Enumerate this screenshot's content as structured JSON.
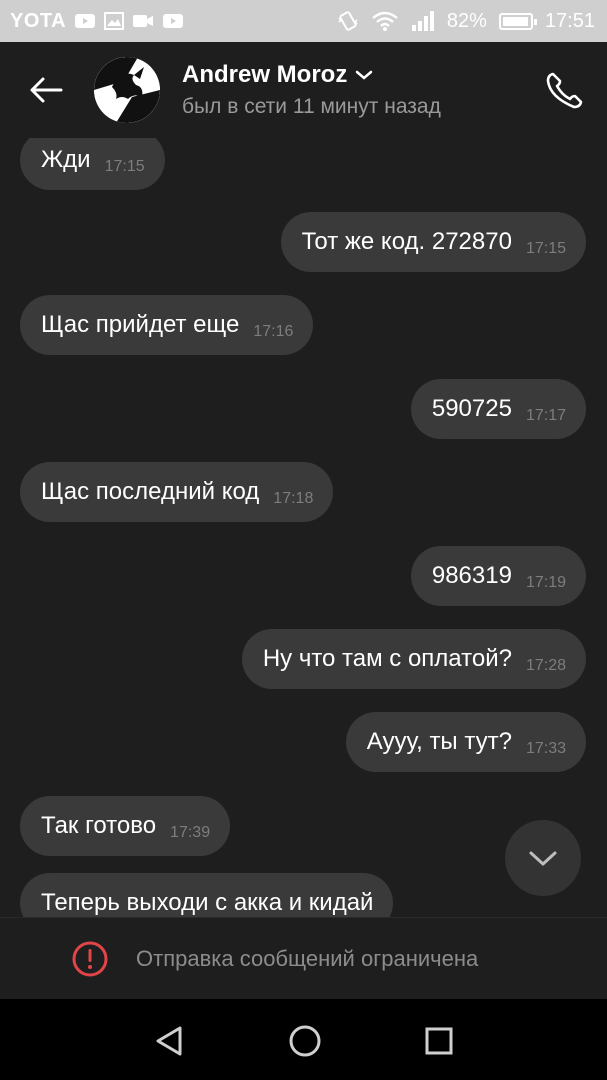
{
  "status_bar": {
    "carrier": "YOTA",
    "battery": "82%",
    "battery_level": 0.82,
    "time": "17:51",
    "icons": [
      "youtube-icon",
      "image-icon",
      "video-icon",
      "youtube-icon",
      "vibrate-icon",
      "wifi-icon",
      "signal-icon",
      "battery-icon"
    ]
  },
  "header": {
    "contact_name": "Andrew Moroz",
    "last_seen": "был в сети 11 минут назад"
  },
  "messages": [
    {
      "side": "in",
      "text": "Жди",
      "time": "17:15"
    },
    {
      "side": "out",
      "text": "Тот же код. 272870",
      "time": "17:15"
    },
    {
      "side": "in",
      "text": "Щас прийдет еще",
      "time": "17:16"
    },
    {
      "side": "out",
      "text": "590725",
      "time": "17:17"
    },
    {
      "side": "in",
      "text": "Щас последний код",
      "time": "17:18"
    },
    {
      "side": "out",
      "text": "986319",
      "time": "17:19"
    },
    {
      "side": "out",
      "text": "Ну что там с оплатой?",
      "time": "17:28"
    },
    {
      "side": "out",
      "text": "Аууу, ты тут?",
      "time": "17:33"
    },
    {
      "side": "in",
      "text": "Так готово",
      "time": "17:39"
    },
    {
      "side": "in",
      "text": "Теперь выходи с акка и кидай",
      "time": ""
    }
  ],
  "restriction": {
    "text": "Отправка сообщений ограничена",
    "accent": "#e0454a"
  },
  "colors": {
    "background": "#1e1e1e",
    "bubble": "#3a3a3a",
    "timestamp": "#7d7d7d"
  }
}
